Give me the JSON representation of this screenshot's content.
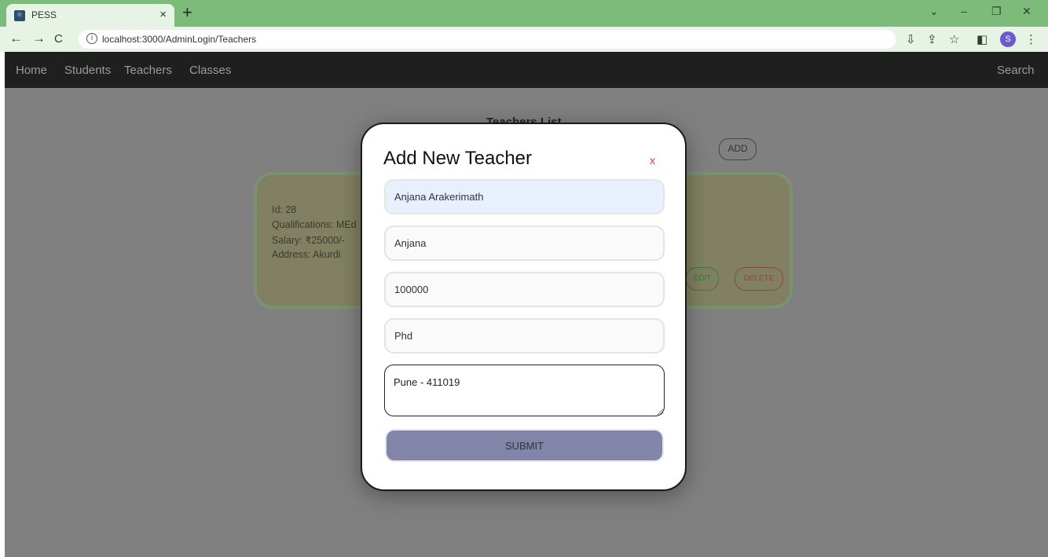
{
  "browser": {
    "tab_title": "PESS",
    "tab_favicon_icon": "react-icon",
    "url": "localhost:3000/AdminLogin/Teachers"
  },
  "navbar": {
    "links": [
      "Home",
      "Students",
      "Teachers",
      "Classes"
    ],
    "search": "Search"
  },
  "page": {
    "title": "Teachers List",
    "add_label": "ADD"
  },
  "card": {
    "lines": [
      "Id: 28",
      "Qualifications: MEd",
      "Salary: ₹25000/-",
      "Address: Akurdi"
    ],
    "edit_label": "EDIT",
    "delete_label": "DELETE"
  },
  "modal": {
    "title": "Add New Teacher",
    "close_label": "x",
    "fields": [
      "Anjana Arakerimath",
      "Anjana",
      "100000",
      "Phd"
    ],
    "address_value": "Pune - 411019",
    "submit_label": "SUBMIT"
  },
  "colors": {
    "tab_strip": "#7dbb7b",
    "modal_close": "#e53935",
    "submit_bg": "#8385a8"
  }
}
